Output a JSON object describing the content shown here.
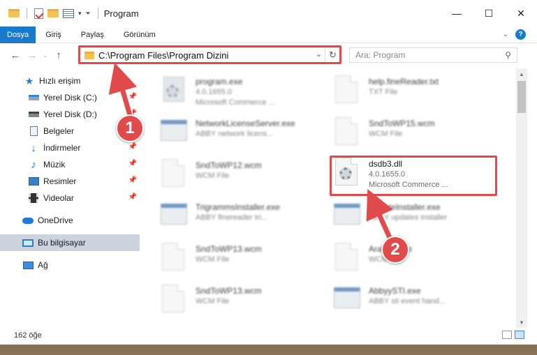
{
  "window": {
    "title": "Program",
    "controls": {
      "minimize": "—",
      "maximize": "☐",
      "close": "✕"
    }
  },
  "ribbon": {
    "tabs": [
      "Dosya",
      "Giriş",
      "Paylaş",
      "Görünüm"
    ],
    "accent": "#1979ca"
  },
  "address": {
    "path": "C:\\Program Files\\Program Dizini",
    "search_placeholder": "Ara: Program"
  },
  "sidebar": {
    "items": [
      {
        "label": "Hızlı erişim",
        "icon": "star-icon"
      },
      {
        "label": "Yerel Disk (C:)",
        "icon": "drive-c-icon",
        "pinned": true
      },
      {
        "label": "Yerel Disk (D:)",
        "icon": "drive-d-icon",
        "pinned": true
      },
      {
        "label": "Belgeler",
        "icon": "documents-icon",
        "pinned": true
      },
      {
        "label": "İndirmeler",
        "icon": "downloads-icon",
        "pinned": true
      },
      {
        "label": "Müzik",
        "icon": "music-icon",
        "pinned": true
      },
      {
        "label": "Resimler",
        "icon": "pictures-icon",
        "pinned": true
      },
      {
        "label": "Videolar",
        "icon": "videos-icon",
        "pinned": true
      },
      {
        "label": "OneDrive",
        "icon": "onedrive-icon"
      },
      {
        "label": "Bu bilgisayar",
        "icon": "this-pc-icon",
        "selected": true
      },
      {
        "label": "Ağ",
        "icon": "network-icon"
      }
    ]
  },
  "files": [
    {
      "name": "program.exe",
      "line2": "4.0.1655.0",
      "line3": "Microsoft Commerce ...",
      "icon": "exe-icon"
    },
    {
      "name": "help.fineReader.txt",
      "line2": "TXT File",
      "line3": "",
      "icon": "file-icon"
    },
    {
      "name": "NetworkLicenseServer.exe",
      "line2": "ABBY network licens...",
      "line3": "",
      "icon": "app-icon"
    },
    {
      "name": "SndToWP15.wcm",
      "line2": "WCM File",
      "line3": "",
      "icon": "file-icon"
    },
    {
      "name": "SndToWP12.wcm",
      "line2": "WCM File",
      "line3": "",
      "icon": "file-icon"
    },
    {
      "name": "dsdb3.dll",
      "line2": "4.0.1655.0",
      "line3": "Microsoft Commerce ...",
      "icon": "dll-gear-icon"
    },
    {
      "name": "TrigrammsInstaller.exe",
      "line2": "ABBY finereader tri...",
      "line3": "",
      "icon": "app-icon"
    },
    {
      "name": "UpdateInstaller.exe",
      "line2": "ABBY updates installer",
      "line3": "",
      "icon": "app-icon"
    },
    {
      "name": "SndToWP13.wcm",
      "line2": "WCM File",
      "line3": "",
      "icon": "file-icon"
    },
    {
      "name": "Arabic.wcm",
      "line2": "WCM File",
      "line3": "",
      "icon": "file-icon"
    },
    {
      "name": "SndToWP13.wcm",
      "line2": "WCM File",
      "line3": "",
      "icon": "file-icon"
    },
    {
      "name": "AbbyySTI.exe",
      "line2": "ABBY sti event hand...",
      "line3": "",
      "icon": "app-icon"
    }
  ],
  "status": {
    "count": "162 öğe"
  },
  "callouts": [
    "1",
    "2"
  ],
  "colors": {
    "highlight": "#e04a4a",
    "selection": "#ccd3dc"
  }
}
